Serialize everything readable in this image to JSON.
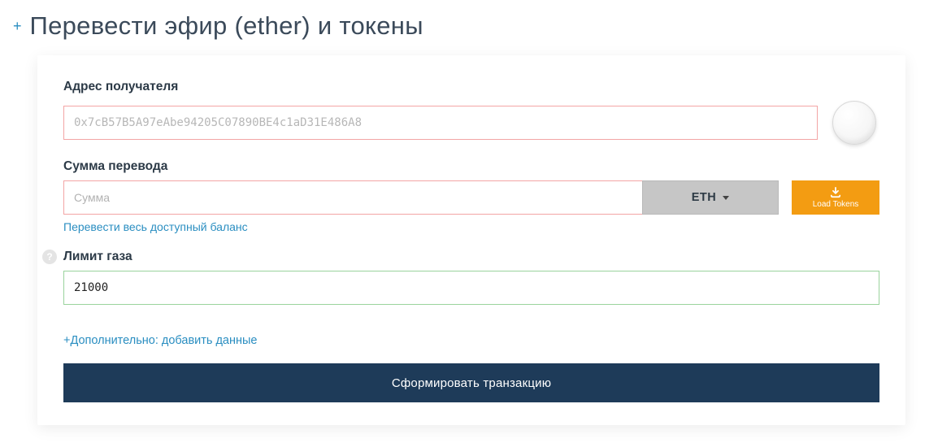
{
  "header": {
    "title": "Перевести эфир (ether) и токены"
  },
  "recipient": {
    "label": "Адрес получателя",
    "placeholder": "0x7cB57B5A97eAbe94205C07890BE4c1aD31E486A8",
    "value": ""
  },
  "amount": {
    "label": "Сумма перевода",
    "placeholder": "Сумма",
    "value": "",
    "currency_selected": "ETH",
    "send_all_link": "Перевести весь доступный баланс"
  },
  "load_tokens": {
    "label": "Load Tokens"
  },
  "gas": {
    "label": "Лимит газа",
    "value": "21000"
  },
  "advanced": {
    "link": "+Дополнительно: добавить данные"
  },
  "submit": {
    "label": "Сформировать транзакцию"
  }
}
